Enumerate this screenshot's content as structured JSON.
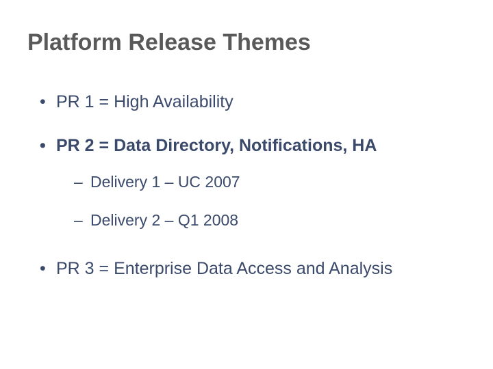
{
  "slide": {
    "title": "Platform Release Themes",
    "items": [
      {
        "text": "PR 1 = High Availability",
        "bold": false
      },
      {
        "text": "PR 2 = Data Directory, Notifications, HA",
        "bold": true,
        "sub": [
          {
            "text": "Delivery 1 – UC 2007"
          },
          {
            "text": "Delivery 2 – Q1 2008"
          }
        ]
      },
      {
        "text": "PR 3 = Enterprise Data Access and Analysis",
        "bold": false,
        "loose": true
      }
    ]
  }
}
